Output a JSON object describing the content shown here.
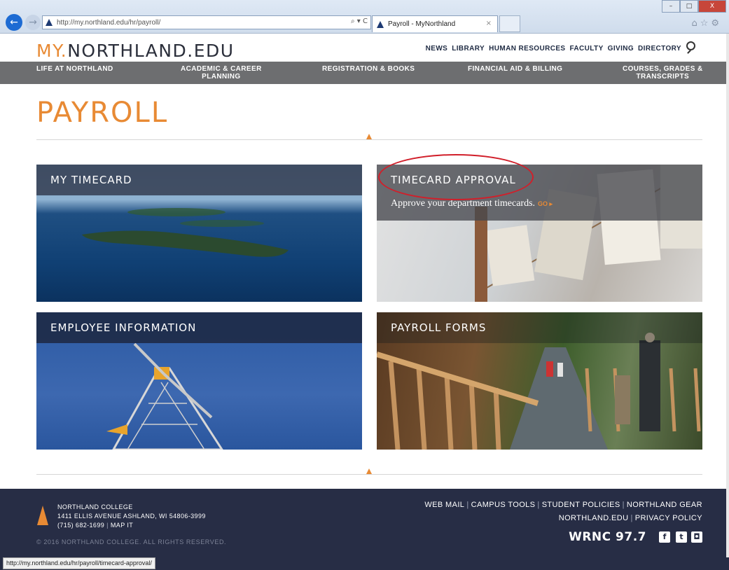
{
  "browser": {
    "url": "http://my.northland.edu/hr/payroll/",
    "tab_title": "Payroll - MyNorthland",
    "tab_close": "×",
    "address_tools": "⌕ ▾ C",
    "back_glyph": "←",
    "forward_glyph": "→",
    "chrome_icons": "⌂☆⚙",
    "window_controls": {
      "minimize": "–",
      "maximize": "□",
      "close": "X"
    },
    "status_url": "http://my.northland.edu/hr/payroll/timecard-approval/"
  },
  "header": {
    "logo_my": "MY.",
    "logo_rest": "NORTHLAND.EDU",
    "utility_links": [
      "NEWS",
      "LIBRARY",
      "HUMAN RESOURCES",
      "FACULTY",
      "GIVING",
      "DIRECTORY"
    ]
  },
  "mainnav": {
    "items": [
      {
        "label": "LIFE AT NORTHLAND",
        "line2": ""
      },
      {
        "label": "ACADEMIC & CAREER",
        "line2": "PLANNING"
      },
      {
        "label": "REGISTRATION & BOOKS",
        "line2": ""
      },
      {
        "label": "FINANCIAL AID & BILLING",
        "line2": ""
      },
      {
        "label": "COURSES, GRADES &",
        "line2": "TRANSCRIPTS"
      }
    ]
  },
  "page": {
    "title": "PAYROLL"
  },
  "tiles": [
    {
      "title": "MY TIMECARD"
    },
    {
      "title": "TIMECARD APPROVAL",
      "tagline": "Approve your department timecards.",
      "go": "GO ▸"
    },
    {
      "title": "EMPLOYEE INFORMATION"
    },
    {
      "title": "PAYROLL FORMS"
    }
  ],
  "footer": {
    "college": "NORTHLAND COLLEGE",
    "address": "1411 ELLIS AVENUE ASHLAND, WI 54806-3999",
    "phone": "(715) 682-1699",
    "map_link": "MAP IT",
    "copyright": "© 2016 NORTHLAND COLLEGE. ALL RIGHTS RESERVED.",
    "links_row1": [
      "WEB MAIL",
      "CAMPUS TOOLS",
      "STUDENT POLICIES",
      "NORTHLAND GEAR"
    ],
    "links_row2": [
      "NORTHLAND.EDU",
      "PRIVACY POLICY"
    ],
    "radio": "WRNC 97.7",
    "social": {
      "facebook": "f",
      "twitter": "t",
      "instagram": "◘"
    }
  },
  "colors": {
    "accent": "#e88a34",
    "footer_bg": "#272d45",
    "nav_bg": "#6d6e70",
    "annotation": "#d11f2a"
  }
}
